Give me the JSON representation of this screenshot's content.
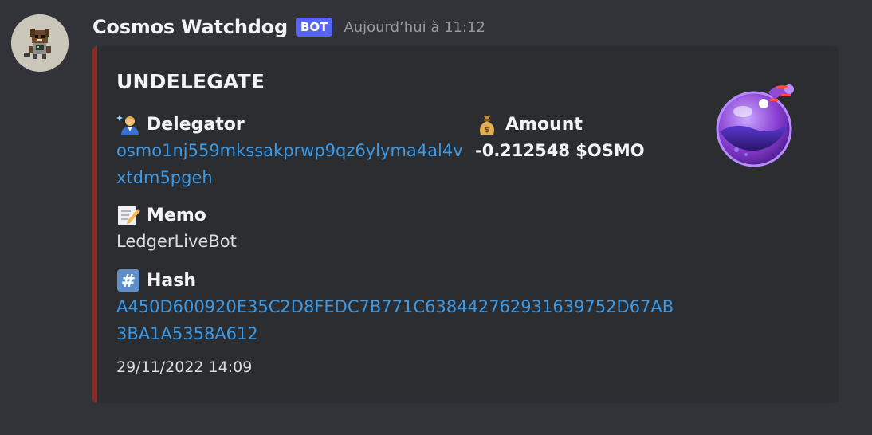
{
  "message": {
    "author": "Cosmos Watchdog",
    "bot_tag": "BOT",
    "timestamp": "Aujourd’hui à 11:12"
  },
  "embed": {
    "accent_color": "#8b2a24",
    "title": "UNDELEGATE",
    "fields": {
      "delegator": {
        "name": "Delegator",
        "emoji": "mage-emoji",
        "value_line1": "osmo1nj559mkssakprwp9qz6ylyma4al4v",
        "value_line2": "xtdm5pgeh"
      },
      "amount": {
        "name": "Amount",
        "emoji": "money-bag-emoji",
        "value": "-0.212548 $OSMO"
      },
      "memo": {
        "name": "Memo",
        "emoji": "memo-emoji",
        "value": "LedgerLiveBot"
      },
      "hash": {
        "name": "Hash",
        "emoji": "hash-keycap-emoji",
        "value_line1": "A450D600920E35C2D8FEDC7B771C638442762931639752D67AB",
        "value_line2": "3BA1A5358A612"
      }
    },
    "footer": "29/11/2022 14:09",
    "thumbnail": "osmosis-potion-icon"
  },
  "colors": {
    "background": "#313338",
    "embed_background": "#2b2d31",
    "link": "#3a9ae8",
    "bot_tag": "#5865f2"
  }
}
